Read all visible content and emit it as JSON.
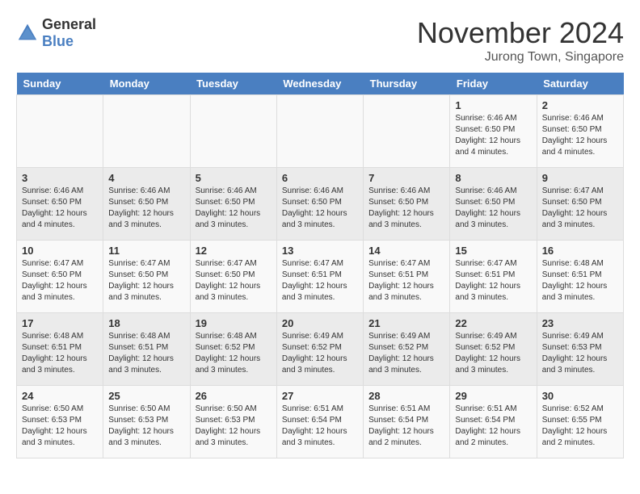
{
  "header": {
    "logo_general": "General",
    "logo_blue": "Blue",
    "month_title": "November 2024",
    "location": "Jurong Town, Singapore"
  },
  "days_of_week": [
    "Sunday",
    "Monday",
    "Tuesday",
    "Wednesday",
    "Thursday",
    "Friday",
    "Saturday"
  ],
  "weeks": [
    [
      {
        "day": "",
        "content": ""
      },
      {
        "day": "",
        "content": ""
      },
      {
        "day": "",
        "content": ""
      },
      {
        "day": "",
        "content": ""
      },
      {
        "day": "",
        "content": ""
      },
      {
        "day": "1",
        "content": "Sunrise: 6:46 AM\nSunset: 6:50 PM\nDaylight: 12 hours and 4 minutes."
      },
      {
        "day": "2",
        "content": "Sunrise: 6:46 AM\nSunset: 6:50 PM\nDaylight: 12 hours and 4 minutes."
      }
    ],
    [
      {
        "day": "3",
        "content": "Sunrise: 6:46 AM\nSunset: 6:50 PM\nDaylight: 12 hours and 4 minutes."
      },
      {
        "day": "4",
        "content": "Sunrise: 6:46 AM\nSunset: 6:50 PM\nDaylight: 12 hours and 3 minutes."
      },
      {
        "day": "5",
        "content": "Sunrise: 6:46 AM\nSunset: 6:50 PM\nDaylight: 12 hours and 3 minutes."
      },
      {
        "day": "6",
        "content": "Sunrise: 6:46 AM\nSunset: 6:50 PM\nDaylight: 12 hours and 3 minutes."
      },
      {
        "day": "7",
        "content": "Sunrise: 6:46 AM\nSunset: 6:50 PM\nDaylight: 12 hours and 3 minutes."
      },
      {
        "day": "8",
        "content": "Sunrise: 6:46 AM\nSunset: 6:50 PM\nDaylight: 12 hours and 3 minutes."
      },
      {
        "day": "9",
        "content": "Sunrise: 6:47 AM\nSunset: 6:50 PM\nDaylight: 12 hours and 3 minutes."
      }
    ],
    [
      {
        "day": "10",
        "content": "Sunrise: 6:47 AM\nSunset: 6:50 PM\nDaylight: 12 hours and 3 minutes."
      },
      {
        "day": "11",
        "content": "Sunrise: 6:47 AM\nSunset: 6:50 PM\nDaylight: 12 hours and 3 minutes."
      },
      {
        "day": "12",
        "content": "Sunrise: 6:47 AM\nSunset: 6:50 PM\nDaylight: 12 hours and 3 minutes."
      },
      {
        "day": "13",
        "content": "Sunrise: 6:47 AM\nSunset: 6:51 PM\nDaylight: 12 hours and 3 minutes."
      },
      {
        "day": "14",
        "content": "Sunrise: 6:47 AM\nSunset: 6:51 PM\nDaylight: 12 hours and 3 minutes."
      },
      {
        "day": "15",
        "content": "Sunrise: 6:47 AM\nSunset: 6:51 PM\nDaylight: 12 hours and 3 minutes."
      },
      {
        "day": "16",
        "content": "Sunrise: 6:48 AM\nSunset: 6:51 PM\nDaylight: 12 hours and 3 minutes."
      }
    ],
    [
      {
        "day": "17",
        "content": "Sunrise: 6:48 AM\nSunset: 6:51 PM\nDaylight: 12 hours and 3 minutes."
      },
      {
        "day": "18",
        "content": "Sunrise: 6:48 AM\nSunset: 6:51 PM\nDaylight: 12 hours and 3 minutes."
      },
      {
        "day": "19",
        "content": "Sunrise: 6:48 AM\nSunset: 6:52 PM\nDaylight: 12 hours and 3 minutes."
      },
      {
        "day": "20",
        "content": "Sunrise: 6:49 AM\nSunset: 6:52 PM\nDaylight: 12 hours and 3 minutes."
      },
      {
        "day": "21",
        "content": "Sunrise: 6:49 AM\nSunset: 6:52 PM\nDaylight: 12 hours and 3 minutes."
      },
      {
        "day": "22",
        "content": "Sunrise: 6:49 AM\nSunset: 6:52 PM\nDaylight: 12 hours and 3 minutes."
      },
      {
        "day": "23",
        "content": "Sunrise: 6:49 AM\nSunset: 6:53 PM\nDaylight: 12 hours and 3 minutes."
      }
    ],
    [
      {
        "day": "24",
        "content": "Sunrise: 6:50 AM\nSunset: 6:53 PM\nDaylight: 12 hours and 3 minutes."
      },
      {
        "day": "25",
        "content": "Sunrise: 6:50 AM\nSunset: 6:53 PM\nDaylight: 12 hours and 3 minutes."
      },
      {
        "day": "26",
        "content": "Sunrise: 6:50 AM\nSunset: 6:53 PM\nDaylight: 12 hours and 3 minutes."
      },
      {
        "day": "27",
        "content": "Sunrise: 6:51 AM\nSunset: 6:54 PM\nDaylight: 12 hours and 3 minutes."
      },
      {
        "day": "28",
        "content": "Sunrise: 6:51 AM\nSunset: 6:54 PM\nDaylight: 12 hours and 2 minutes."
      },
      {
        "day": "29",
        "content": "Sunrise: 6:51 AM\nSunset: 6:54 PM\nDaylight: 12 hours and 2 minutes."
      },
      {
        "day": "30",
        "content": "Sunrise: 6:52 AM\nSunset: 6:55 PM\nDaylight: 12 hours and 2 minutes."
      }
    ]
  ]
}
